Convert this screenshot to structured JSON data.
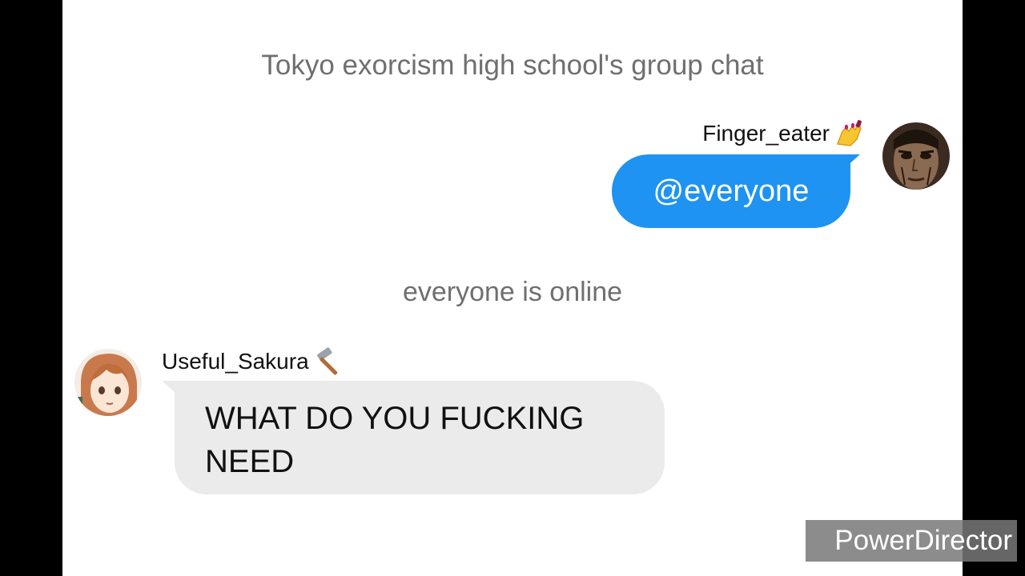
{
  "chat": {
    "title": "Tokyo exorcism high school's group chat",
    "system_message": "everyone is online"
  },
  "messages": [
    {
      "sender": "Finger_eater",
      "sender_emoji": "nail-polish-hand-emoji",
      "avatar": "dark-face-avatar",
      "text": "@everyone",
      "direction": "outgoing",
      "bubble_color": "#1e93f2"
    },
    {
      "sender": "Useful_Sakura",
      "sender_emoji": "hammer-emoji",
      "avatar": "anime-girl-avatar",
      "text": "WHAT DO YOU FUCKING NEED",
      "direction": "incoming",
      "bubble_color": "#ebebeb"
    }
  ],
  "watermark": "PowerDirector"
}
